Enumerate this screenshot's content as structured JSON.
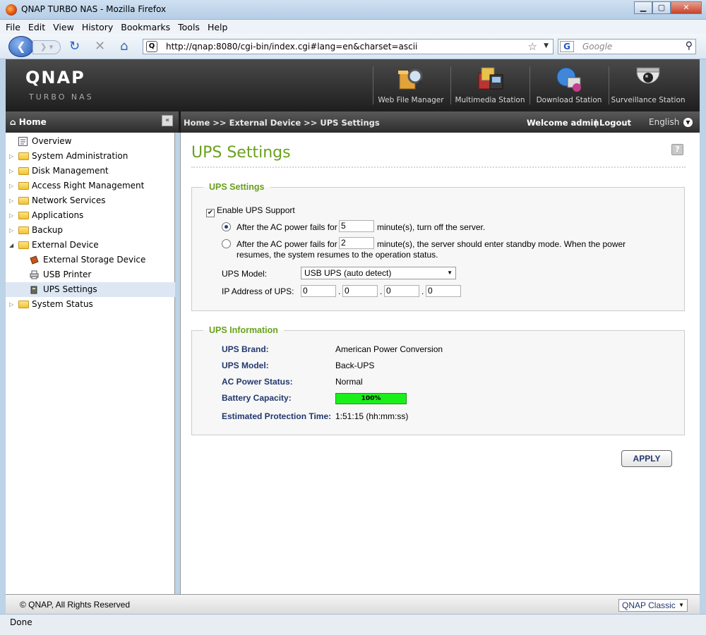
{
  "window": {
    "title": "QNAP TURBO NAS - Mozilla Firefox",
    "min": "▁",
    "max": "▢",
    "close": "✕"
  },
  "menu": [
    "File",
    "Edit",
    "View",
    "History",
    "Bookmarks",
    "Tools",
    "Help"
  ],
  "nav": {
    "url": "http://qnap:8080/cgi-bin/index.cgi#lang=en&charset=ascii",
    "search_placeholder": "Google"
  },
  "header": {
    "logo": "QNAP",
    "subtitle": "Turbo NAS",
    "stations": [
      "Web File Manager",
      "Multimedia Station",
      "Download Station",
      "Surveillance Station"
    ]
  },
  "topbar": {
    "home": "Home",
    "breadcrumb": "Home >> External Device >> UPS Settings",
    "welcome": "Welcome admin",
    "separator": "|",
    "logout": "Logout",
    "language": "English"
  },
  "sidebar": {
    "items": [
      {
        "label": "Overview"
      },
      {
        "label": "System Administration"
      },
      {
        "label": "Disk Management"
      },
      {
        "label": "Access Right Management"
      },
      {
        "label": "Network Services"
      },
      {
        "label": "Applications"
      },
      {
        "label": "Backup"
      },
      {
        "label": "External Device"
      },
      {
        "label": "External Storage Device"
      },
      {
        "label": "USB Printer"
      },
      {
        "label": "UPS Settings"
      },
      {
        "label": "System Status"
      }
    ]
  },
  "page": {
    "title": "UPS Settings",
    "help": "?",
    "settings": {
      "legend": "UPS Settings",
      "enable_label": "Enable UPS Support",
      "opt1_prefix": "After the AC power fails for",
      "opt1_value": "5",
      "opt1_suffix": "minute(s), turn off the server.",
      "opt2_prefix": "After the AC power fails for",
      "opt2_value": "2",
      "opt2_suffix": "minute(s), the server should enter standby mode. When the power",
      "opt2_line2": "resumes, the system resumes to the operation status.",
      "model_label": "UPS Model:",
      "model_value": "USB UPS (auto detect)",
      "ip_label": "IP Address of UPS:",
      "ip": [
        "0",
        "0",
        "0",
        "0"
      ]
    },
    "info": {
      "legend": "UPS Information",
      "brand_label": "UPS Brand:",
      "brand_value": "American Power Conversion",
      "model_label": "UPS Model:",
      "model_value": "Back-UPS",
      "ac_label": "AC Power Status:",
      "ac_value": "Normal",
      "battery_label": "Battery Capacity:",
      "battery_value": "100%",
      "battery_fraction": 1.0,
      "ept_label": "Estimated Protection Time:",
      "ept_value": "1:51:15 (hh:mm:ss)"
    },
    "apply": "APPLY"
  },
  "footer": {
    "copyright": "© QNAP, All Rights Reserved",
    "theme": "QNAP Classic"
  },
  "statusbar": "Done"
}
